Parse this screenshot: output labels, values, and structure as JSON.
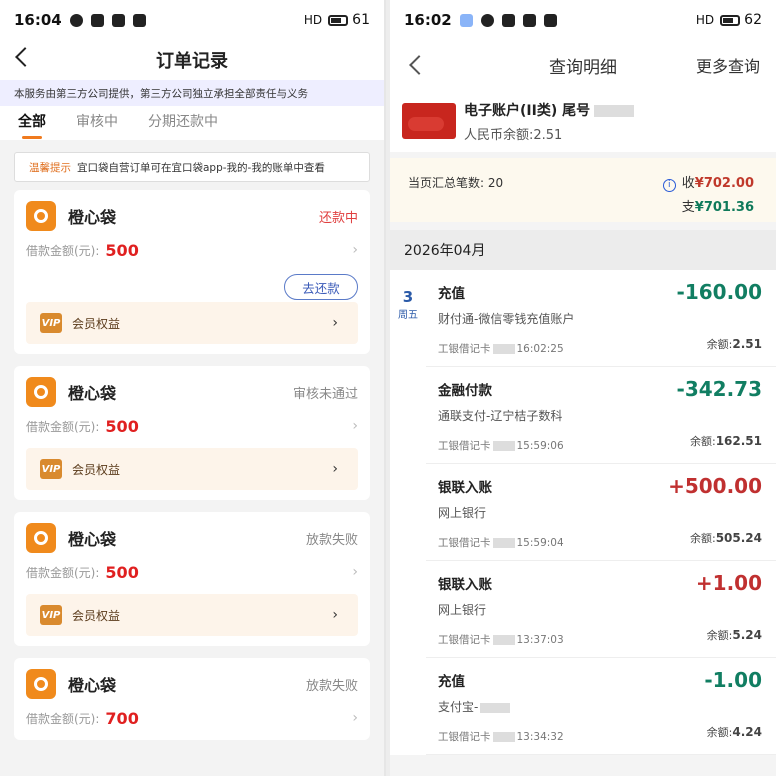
{
  "left": {
    "status": {
      "time": "16:04",
      "signal": "HD",
      "battery": "61"
    },
    "title": "订单记录",
    "notice": "本服务由第三方公司提供，第三方公司独立承担全部责任与义务",
    "tabs": [
      "全部",
      "审核中",
      "分期还款中"
    ],
    "tip": {
      "tag": "温馨提示",
      "text": "宜口袋自营订单可在宜口袋app-我的-我的账单中查看"
    },
    "loan_label": "借款金额(元):",
    "vip_label": "会员权益",
    "vip_badge": "VIP",
    "pay_button": "去还款",
    "cards": [
      {
        "name": "橙心袋",
        "status": "还款中",
        "amount": "500"
      },
      {
        "name": "橙心袋",
        "status": "审核未通过",
        "amount": "500"
      },
      {
        "name": "橙心袋",
        "status": "放款失败",
        "amount": "500"
      },
      {
        "name": "橙心袋",
        "status": "放款失败",
        "amount": "700"
      }
    ],
    "colors": {
      "accent": "#f07a1e",
      "amount": "#e02020",
      "status_red": "#e04040"
    }
  },
  "right": {
    "status": {
      "time": "16:02",
      "signal": "HD",
      "battery": "62"
    },
    "title": "查询明细",
    "more": "更多查询",
    "account": {
      "name": "电子账户(II类) 尾号",
      "balance": "人民币余额:2.51"
    },
    "summary": {
      "count": "当页汇总笔数: 20",
      "income_label": "收",
      "income": "¥702.00",
      "outgo_label": "支",
      "outgo": "¥701.36"
    },
    "month": "2026年04月",
    "day": {
      "d": "3",
      "w": "周五"
    },
    "transactions": [
      {
        "name": "充值",
        "desc": "财付通-微信零钱充值账户",
        "card": "工银借记卡",
        "time": "16:02:25",
        "amount": "-160.00",
        "balance": "2.51"
      },
      {
        "name": "金融付款",
        "desc": "通联支付-辽宁桔子数科",
        "card": "工银借记卡",
        "time": "15:59:06",
        "amount": "-342.73",
        "balance": "162.51"
      },
      {
        "name": "银联入账",
        "desc": "网上银行",
        "card": "工银借记卡",
        "time": "15:59:04",
        "amount": "+500.00",
        "balance": "505.24"
      },
      {
        "name": "银联入账",
        "desc": "网上银行",
        "card": "工银借记卡",
        "time": "13:37:03",
        "amount": "+1.00",
        "balance": "5.24"
      },
      {
        "name": "充值",
        "desc": "支付宝-",
        "card": "工银借记卡",
        "time": "13:34:32",
        "amount": "-1.00",
        "balance": "4.24"
      }
    ],
    "balance_label": "余额:",
    "colors": {
      "neg": "#117e62",
      "pos": "#c03030"
    }
  }
}
